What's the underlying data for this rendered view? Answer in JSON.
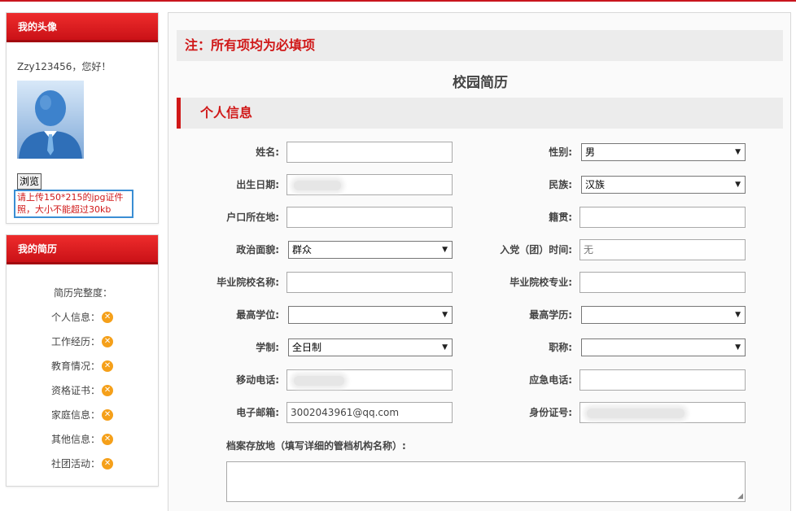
{
  "sidebar": {
    "avatar_panel": {
      "title": "我的头像",
      "greeting": "Zzy123456，您好！",
      "browse_label": "浏览",
      "upload_tip": "请上传150*215的jpg证件照，大小不能超过30kb"
    },
    "resume_panel": {
      "title": "我的简历",
      "completeness_label": "简历完整度：",
      "items": [
        {
          "label": "个人信息：",
          "status": "incomplete"
        },
        {
          "label": "工作经历：",
          "status": "incomplete"
        },
        {
          "label": "教育情况：",
          "status": "incomplete"
        },
        {
          "label": "资格证书：",
          "status": "incomplete"
        },
        {
          "label": "家庭信息：",
          "status": "incomplete"
        },
        {
          "label": "其他信息：",
          "status": "incomplete"
        },
        {
          "label": "社团活动：",
          "status": "incomplete"
        }
      ],
      "status_icon": "close-circle-icon"
    }
  },
  "main": {
    "notice": "注：所有项均为必填项",
    "title": "校园简历",
    "section_title": "个人信息",
    "fields": {
      "name": {
        "label": "姓名:",
        "value": ""
      },
      "gender": {
        "label": "性别:",
        "value": "男"
      },
      "birthdate": {
        "label": "出生日期:",
        "value": ""
      },
      "ethnicity": {
        "label": "民族:",
        "value": "汉族"
      },
      "hukou": {
        "label": "户口所在地:",
        "value": ""
      },
      "native_place": {
        "label": "籍贯:",
        "value": ""
      },
      "political_status": {
        "label": "政治面貌:",
        "value": "群众"
      },
      "party_join_time": {
        "label": "入党（团）时间:",
        "value": "无"
      },
      "school": {
        "label": "毕业院校名称:",
        "value": ""
      },
      "major": {
        "label": "毕业院校专业:",
        "value": ""
      },
      "degree": {
        "label": "最高学位:",
        "value": ""
      },
      "education": {
        "label": "最高学历:",
        "value": ""
      },
      "study_mode": {
        "label": "学制:",
        "value": "全日制"
      },
      "job_title": {
        "label": "职称:",
        "value": ""
      },
      "mobile": {
        "label": "移动电话:",
        "value": ""
      },
      "emergency_phone": {
        "label": "应急电话:",
        "value": ""
      },
      "email": {
        "label": "电子邮箱:",
        "value": "3002043961@qq.com"
      },
      "id_number": {
        "label": "身份证号:",
        "value": ""
      }
    },
    "archive_label": "档案存放地（填写详细的管档机构名称）:",
    "archive_value": ""
  },
  "colors": {
    "brand_red": "#d01818",
    "icon_orange": "#f5a01a",
    "highlight_blue": "#3a8ed4"
  }
}
